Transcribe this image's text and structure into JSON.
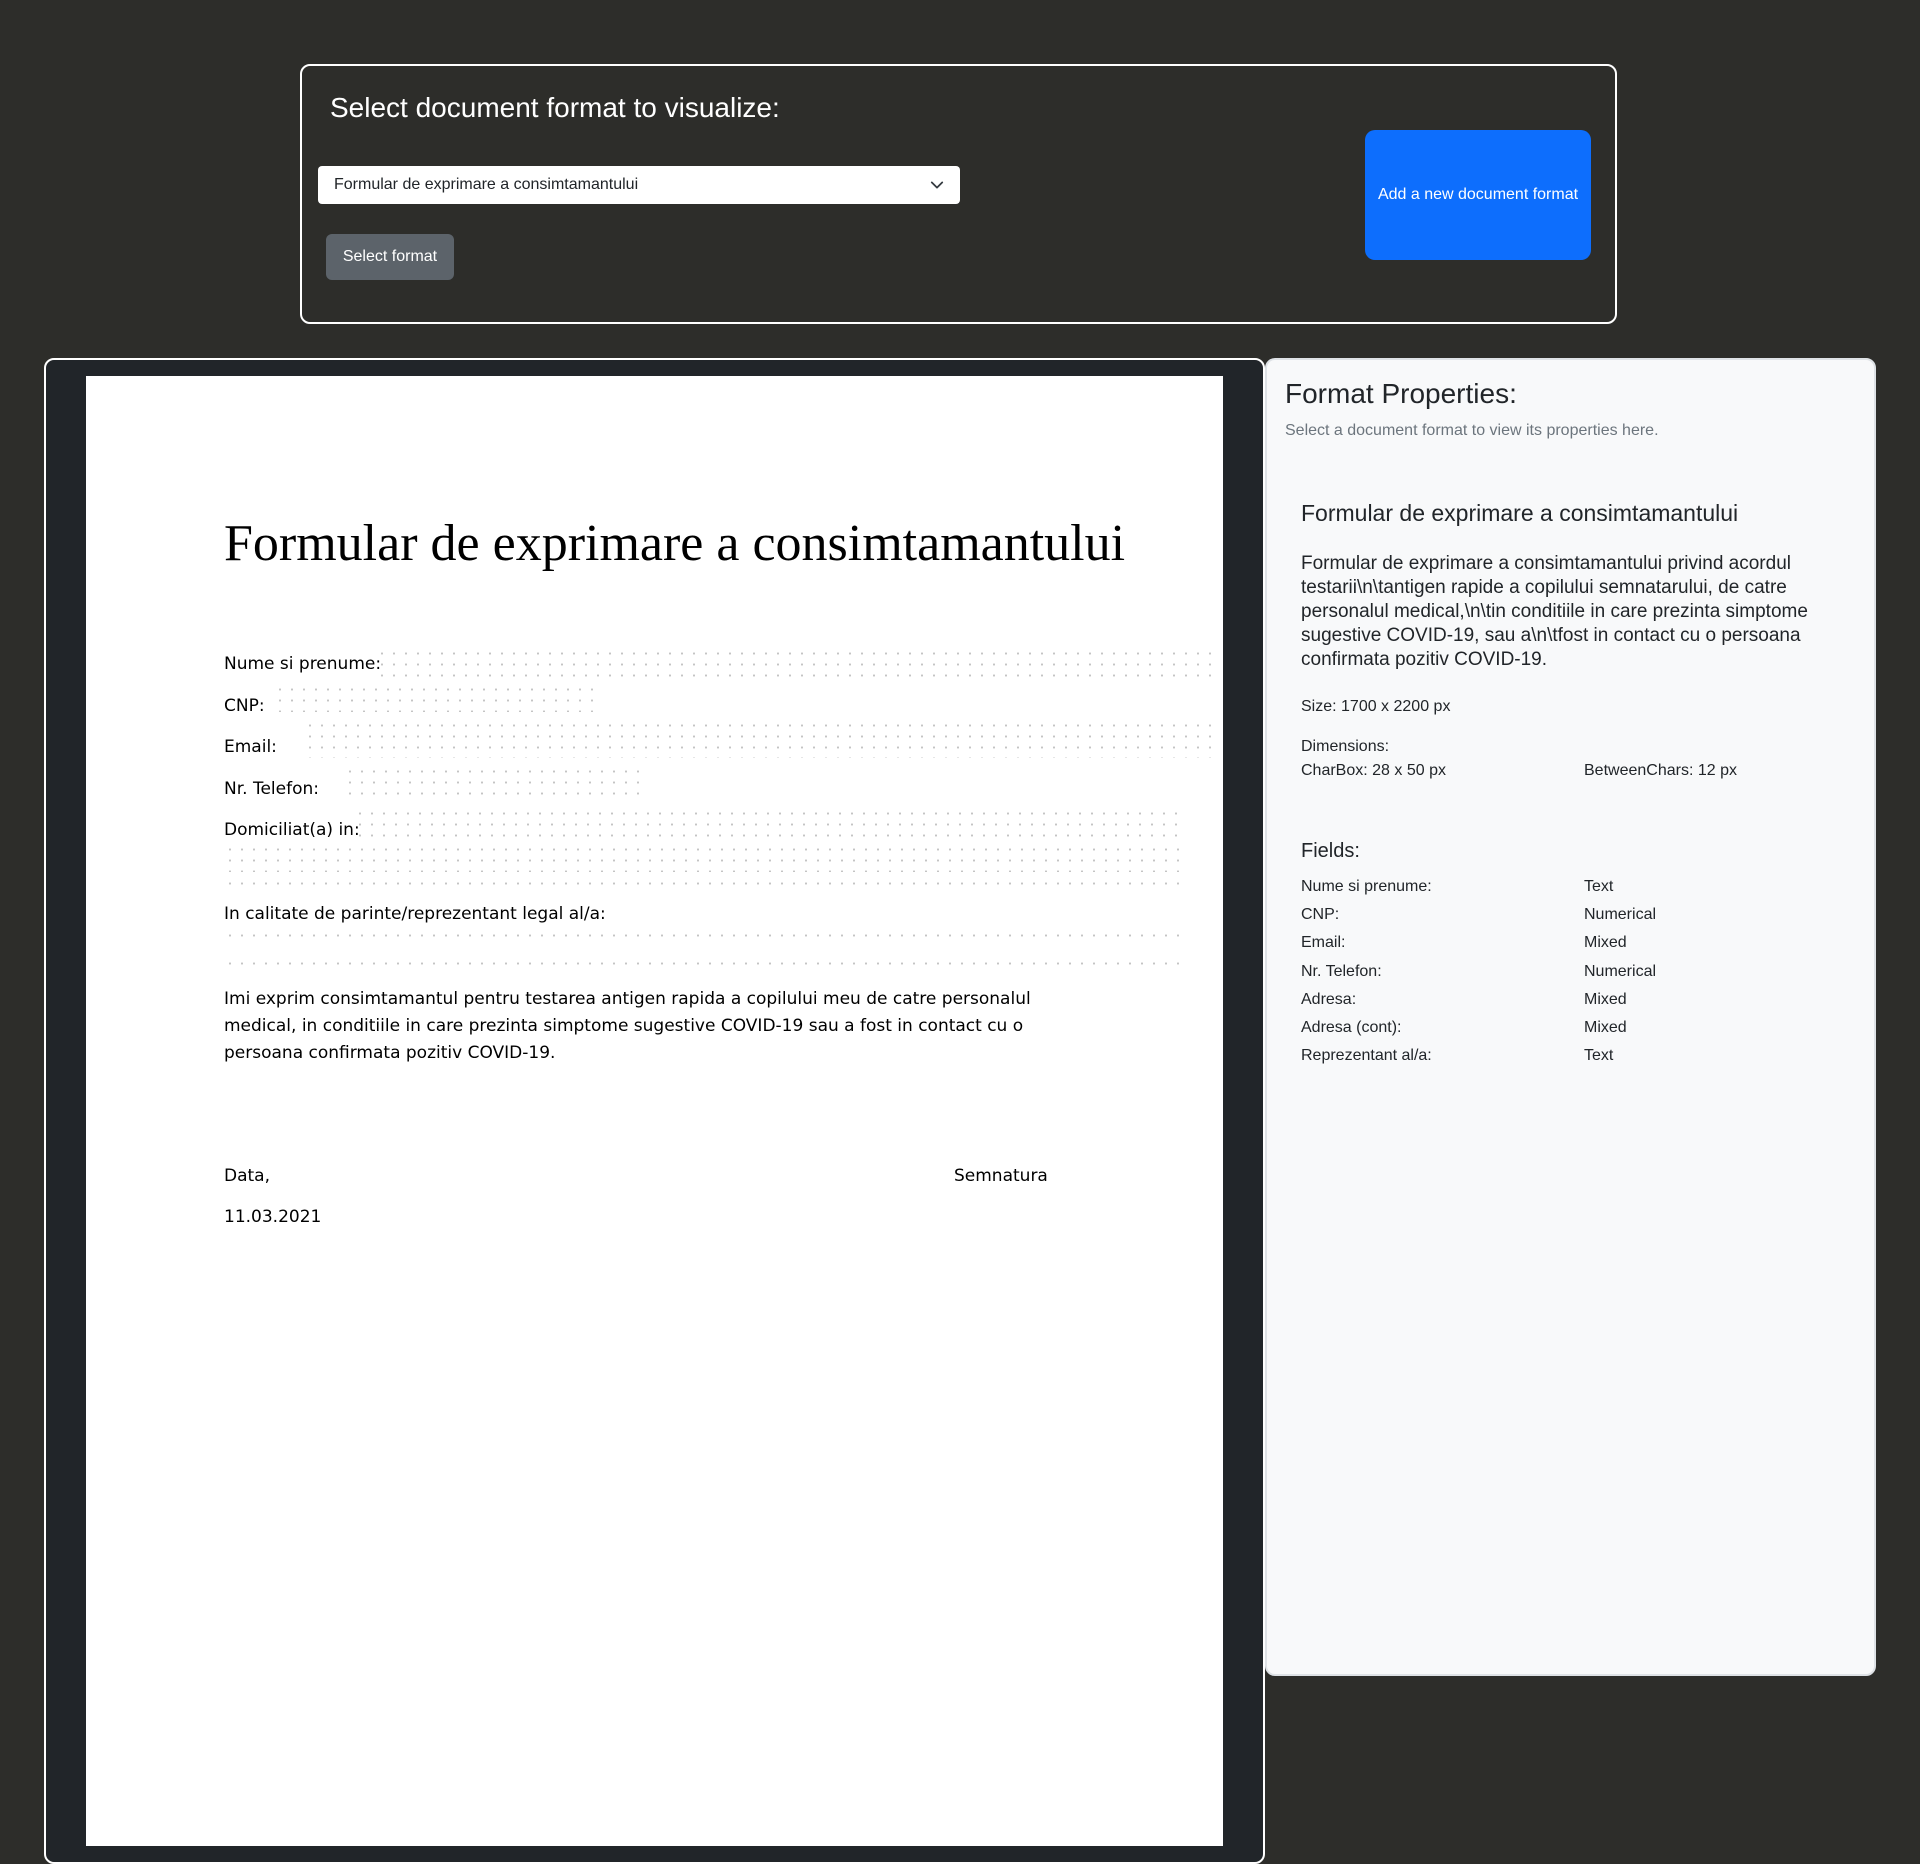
{
  "selector": {
    "title": "Select document format to visualize:",
    "selected_value": "Formular de exprimare a consimtamantului",
    "select_button_label": "Select format",
    "add_button_label": "Add a new document format"
  },
  "document": {
    "title": "Formular de exprimare a consimtamantului",
    "fields": {
      "name_label": "Nume si prenume:",
      "cnp_label": "CNP:",
      "email_label": "Email:",
      "phone_label": "Nr. Telefon:",
      "address_label": "Domiciliat(a) in:",
      "guardian_label": "In calitate de parinte/reprezentant legal al/a:"
    },
    "consent_text": "Imi exprim consimtamantul pentru testarea antigen rapida a copilului meu de catre personalul medical, in conditiile in care prezinta simptome sugestive COVID-19 sau a fost in contact cu o persoana confirmata pozitiv COVID-19.",
    "date_label": "Data,",
    "date_value": "11.03.2021",
    "signature_label": "Semnatura"
  },
  "properties": {
    "title": "Format Properties:",
    "hint": "Select a document format to view its properties here.",
    "format_name": "Formular de exprimare a consimtamantului",
    "description": "Formular de exprimare a consimtamantului privind acordul testarii\\n\\tantigen rapide a copilului semnatarului, de catre personalul medical,\\n\\tin conditiile in care prezinta simptome sugestive COVID-19, sau a\\n\\tfost in contact cu o persoana confirmata pozitiv COVID-19.",
    "size": "Size: 1700 x 2200 px",
    "dimensions_label": "Dimensions:",
    "charbox": "CharBox: 28 x 50 px",
    "between_chars": "BetweenChars: 12 px",
    "fields_heading": "Fields:",
    "fields": [
      {
        "name": "Nume si prenume:",
        "type": "Text"
      },
      {
        "name": "CNP:",
        "type": "Numerical"
      },
      {
        "name": "Email:",
        "type": "Mixed"
      },
      {
        "name": "Nr. Telefon:",
        "type": "Numerical"
      },
      {
        "name": "Adresa:",
        "type": "Mixed"
      },
      {
        "name": "Adresa (cont):",
        "type": "Mixed"
      },
      {
        "name": "Reprezentant al/a:",
        "type": "Text"
      }
    ]
  },
  "colors": {
    "page_background": "#2d2d2a",
    "primary_button": "#0d6efd",
    "secondary_button": "#5c636a",
    "preview_frame": "#212529",
    "properties_panel": "#f8f9fa"
  },
  "icons": {
    "select_dropdown": "chevron-down-icon"
  }
}
